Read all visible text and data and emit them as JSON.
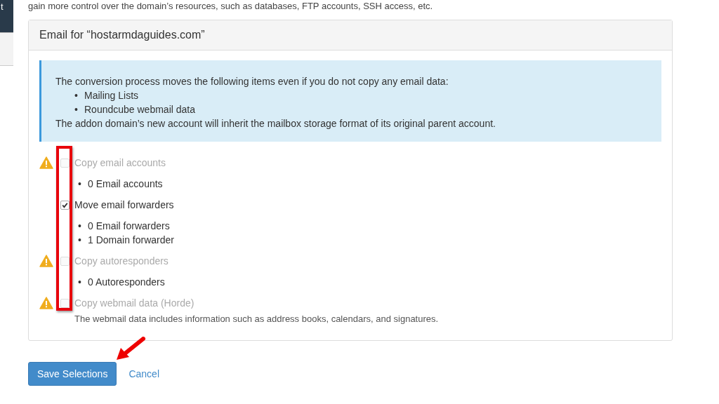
{
  "sidebar": {
    "items": [
      {
        "label": "t",
        "selected": true
      }
    ]
  },
  "intro": "gain more control over the domain’s resources, such as databases, FTP accounts, SSH access, etc.",
  "panel": {
    "title": "Email for “hostarmdaguides.com”",
    "info": {
      "marker": "•",
      "lead": "The conversion process moves the following items even if you do not copy any email data:",
      "items": [
        "Mailing Lists",
        "Roundcube webmail data"
      ],
      "footer": "The addon domain’s new account will inherit the mailbox storage format of its original parent account."
    },
    "option_marker": "•",
    "options": [
      {
        "label": "Copy email accounts",
        "checked": false,
        "disabled": true,
        "warning": true,
        "details": [
          "0 Email accounts"
        ]
      },
      {
        "label": "Move email forwarders",
        "checked": true,
        "disabled": false,
        "warning": false,
        "details": [
          "0 Email forwarders",
          "1 Domain forwarder"
        ]
      },
      {
        "label": "Copy autoresponders",
        "checked": false,
        "disabled": true,
        "warning": true,
        "details": [
          "0 Autoresponders"
        ]
      },
      {
        "label": "Copy webmail data (Horde)",
        "checked": false,
        "disabled": true,
        "warning": true,
        "note": "The webmail data includes information such as address books, calendars, and signatures."
      }
    ]
  },
  "buttons": {
    "save": "Save Selections",
    "cancel": "Cancel"
  }
}
